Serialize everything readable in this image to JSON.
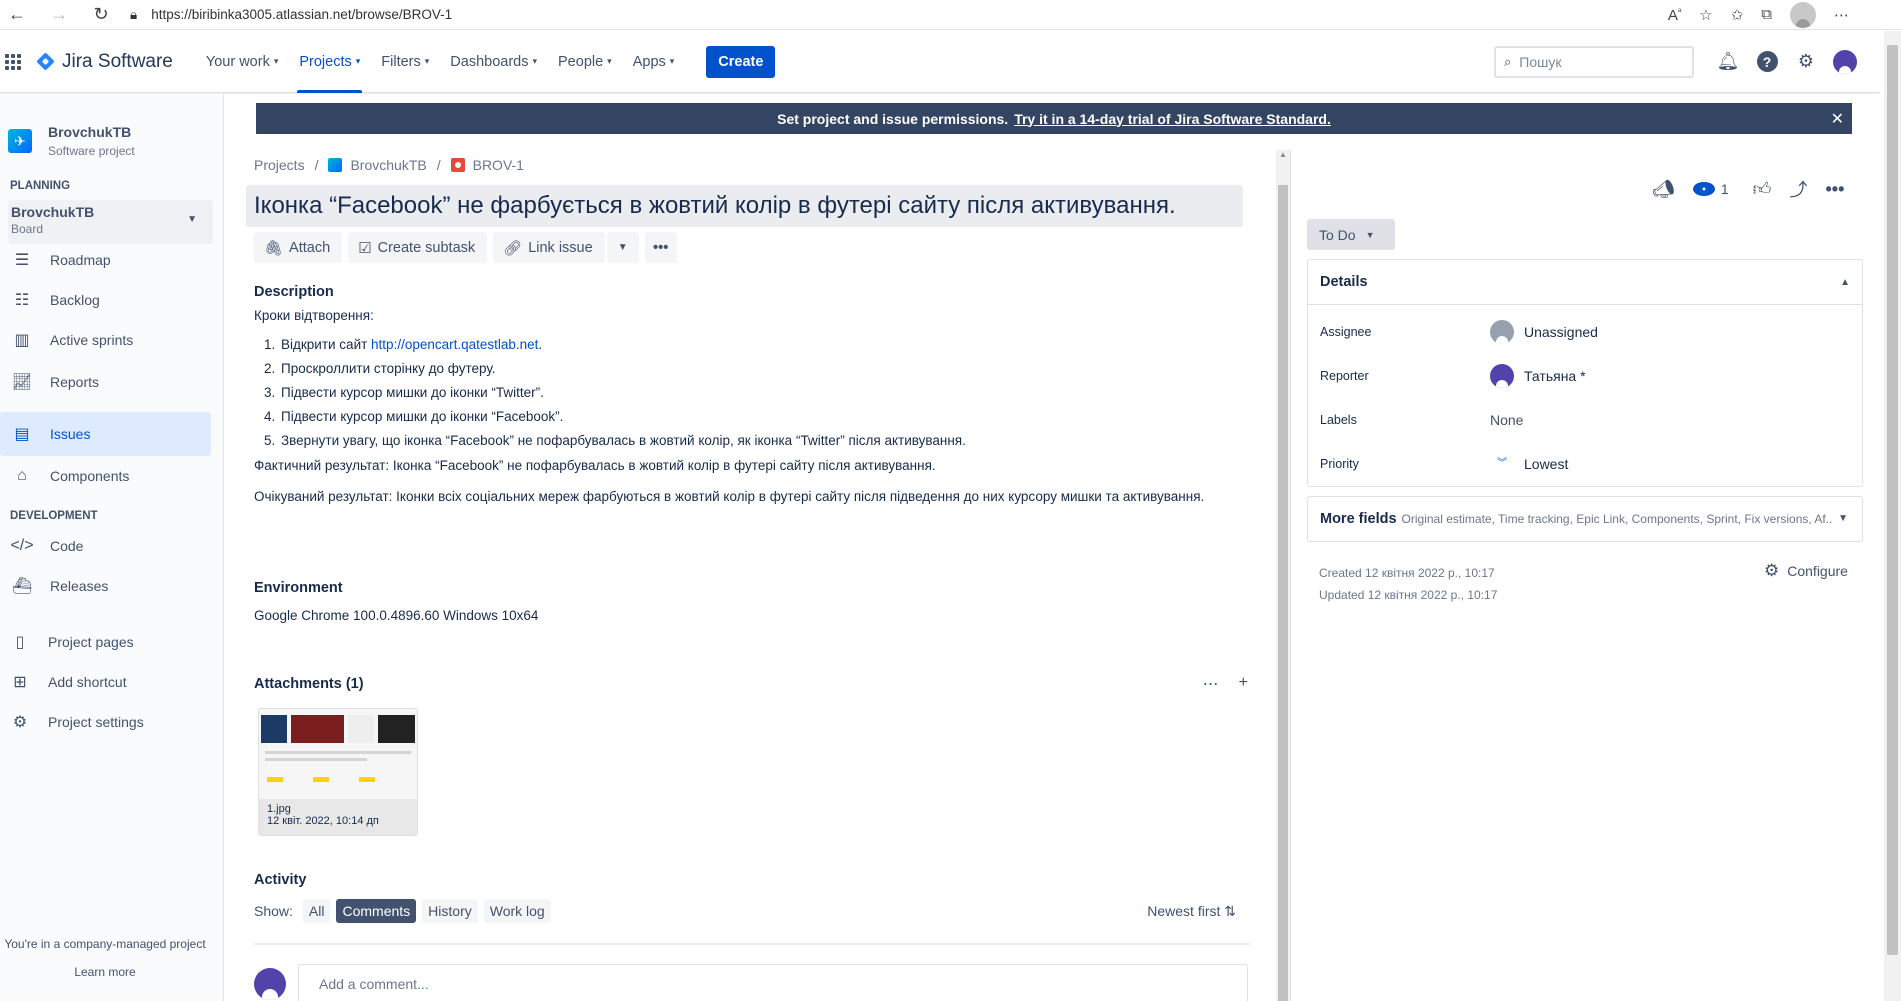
{
  "browser": {
    "url": "https://biribinka3005.atlassian.net/browse/BROV-1"
  },
  "topnav": {
    "logo_text": "Jira Software",
    "links": [
      {
        "label": "Your work"
      },
      {
        "label": "Projects"
      },
      {
        "label": "Filters"
      },
      {
        "label": "Dashboards"
      },
      {
        "label": "People"
      },
      {
        "label": "Apps"
      }
    ],
    "create_label": "Create",
    "search_placeholder": "Пошук"
  },
  "sidebar": {
    "project_name": "BrovchukTB",
    "project_type": "Software project",
    "planning_label": "PLANNING",
    "board_name": "BrovchukTB",
    "board_sub": "Board",
    "items": [
      {
        "label": "Roadmap",
        "icon": "roadmap-icon"
      },
      {
        "label": "Backlog",
        "icon": "backlog-icon"
      },
      {
        "label": "Active sprints",
        "icon": "board-icon"
      },
      {
        "label": "Reports",
        "icon": "reports-icon"
      },
      {
        "label": "Issues",
        "icon": "issues-icon"
      },
      {
        "label": "Components",
        "icon": "components-icon"
      },
      {
        "label": "Code",
        "icon": "code-icon"
      },
      {
        "label": "Releases",
        "icon": "releases-icon"
      },
      {
        "label": "Project pages",
        "icon": "page-icon"
      },
      {
        "label": "Add shortcut",
        "icon": "add-shortcut-icon"
      },
      {
        "label": "Project settings",
        "icon": "gear-icon"
      }
    ],
    "development_label": "DEVELOPMENT",
    "footer_text": "You're in a company-managed project",
    "learn_more": "Learn more"
  },
  "banner": {
    "text": "Set project and issue permissions.",
    "link": "Try it in a 14-day trial of Jira Software Standard."
  },
  "breadcrumbs": [
    "Projects",
    "BrovchukTB",
    "BROV-1"
  ],
  "issue": {
    "title": "Іконка “Facebook” не фарбується в жовтий колір в футері сайту після активування.",
    "actions": {
      "attach": "Attach",
      "create_subtask": "Create subtask",
      "link_issue": "Link issue"
    },
    "description_label": "Description",
    "description_intro": "Кроки відтворення:",
    "steps": [
      {
        "text": "Відкрити сайт ",
        "link": "http://opencart.qatestlab.net",
        "after": "."
      },
      {
        "text": "Проскроллити сторінку до футеру."
      },
      {
        "text": "Підвести курсор мишки до іконки “Twitter”."
      },
      {
        "text": "Підвести курсор мишки до іконки “Facebook”."
      },
      {
        "text": "Звернути увагу, що іконка “Facebook” не пофарбувалась в жовтий колір, як іконка “Twitter” після активування."
      }
    ],
    "actual_result": "Фактичний результат: Іконка “Facebook” не пофарбувалась в жовтий колір в футері сайту після активування.",
    "expected_result": "Очікуваний результат: Іконки всіх соціальних мереж фарбуються в жовтий колір в футері сайту після  підведення до них курсору мишки та активування.",
    "environment_label": "Environment",
    "environment": "Google Chrome 100.0.4896.60 Windows 10x64",
    "attachments_label": "Attachments (1)",
    "attachment": {
      "name": "1.jpg",
      "date": "12 квіт. 2022, 10:14 дп"
    },
    "activity_label": "Activity",
    "show_label": "Show:",
    "activity_filters": [
      "All",
      "Comments",
      "History",
      "Work log"
    ],
    "selected_filter": "Comments",
    "sort_label": "Newest first",
    "comment_placeholder": "Add a comment..."
  },
  "right_panel": {
    "watch_count": "1",
    "status": "To Do",
    "details_label": "Details",
    "fields": [
      {
        "label": "Assignee",
        "value": "Unassigned"
      },
      {
        "label": "Reporter",
        "value": "Татьяна *"
      },
      {
        "label": "Labels",
        "value": "None"
      },
      {
        "label": "Priority",
        "value": "Lowest"
      }
    ],
    "more_fields_label": "More fields",
    "more_fields_sub": "Original estimate, Time tracking, Epic Link, Components, Sprint, Fix versions, Af...",
    "created": "Created 12 квітня 2022 р., 10:17",
    "updated": "Updated 12 квітня 2022 р., 10:17",
    "configure": "Configure"
  },
  "colors": {
    "brand_blue": "#0052CC",
    "banner_bg": "#344563",
    "priority_lowest": "#0065FF",
    "bug_red": "#E5493A"
  }
}
